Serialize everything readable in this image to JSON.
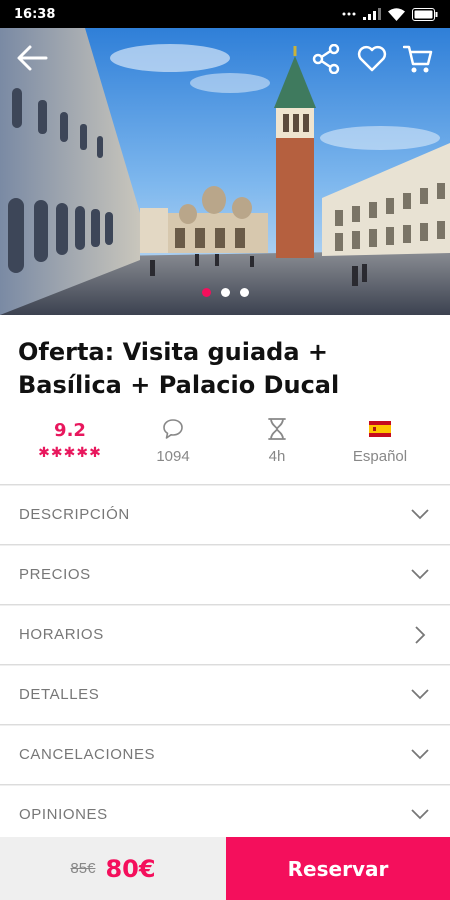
{
  "status_bar": {
    "time": "16:38",
    "icons": [
      "more-icon",
      "signal-icon",
      "wifi-icon",
      "battery-icon"
    ]
  },
  "hero": {
    "image_subject": "Plaza de San Marcos, Venecia",
    "slide_index": 1,
    "slide_count": 3,
    "icons": [
      "back-arrow-icon",
      "share-icon",
      "heart-icon",
      "cart-icon"
    ]
  },
  "tour": {
    "title_line1": "Oferta: Visita guiada +",
    "title_line2": "Basílica + Palacio Ducal"
  },
  "stats": {
    "rating": "9.2",
    "stars": 5,
    "comments": "1094",
    "duration": "4h",
    "language": "Español",
    "icons": [
      "comment-icon",
      "hourglass-icon",
      "spain-flag-icon"
    ]
  },
  "sections": [
    {
      "label": "DESCRIPCIÓN",
      "arrow": "chevron-down-icon"
    },
    {
      "label": "PRECIOS",
      "arrow": "chevron-down-icon"
    },
    {
      "label": "HORARIOS",
      "arrow": "chevron-right-icon"
    },
    {
      "label": "DETALLES",
      "arrow": "chevron-down-icon"
    },
    {
      "label": "CANCELACIONES",
      "arrow": "chevron-down-icon"
    },
    {
      "label": "OPINIONES",
      "arrow": "chevron-down-icon"
    }
  ],
  "booking": {
    "old_price": "85€",
    "new_price": "80€",
    "button_label": "Reservar"
  },
  "colors": {
    "accent": "#f40f5c",
    "rating": "#e8175d",
    "muted_text": "#777777",
    "price_panel": "#efefef"
  }
}
